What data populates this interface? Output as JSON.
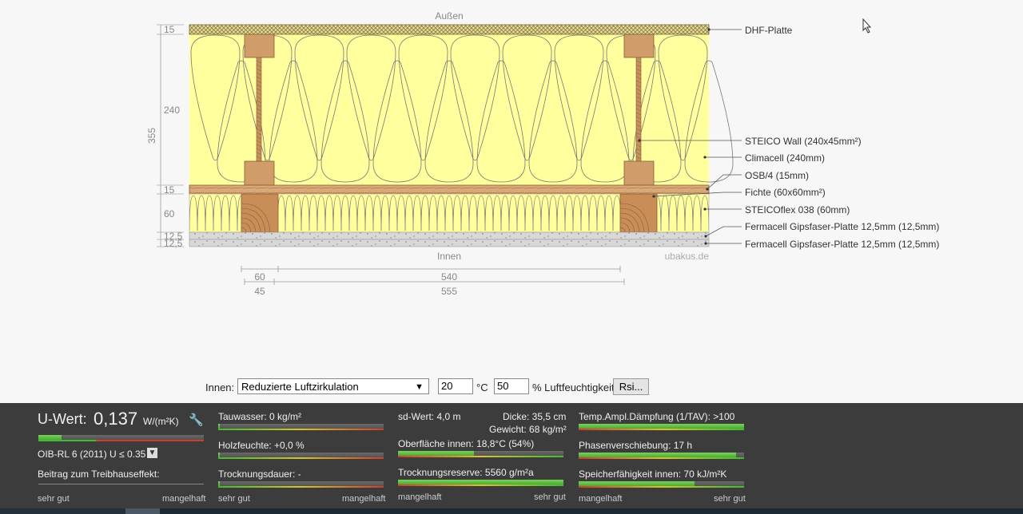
{
  "diagram": {
    "outside_label": "Außen",
    "inside_label": "Innen",
    "watermark": "ubakus.de",
    "left_dims": [
      "15",
      "240",
      "15",
      "60",
      "12,5",
      "12,5"
    ],
    "total_dim": "355",
    "bottom_dims": [
      "60",
      "540",
      "45",
      "555"
    ],
    "layer_labels": [
      "DHF-Platte",
      "STEICO  Wall (240x45mm²)",
      "Climacell (240mm)",
      "OSB/4 (15mm)",
      "Fichte (60x60mm²)",
      "STEICOflex 038 (60mm)",
      "Fermacell Gipsfaser-Platte 12,5mm (12,5mm)",
      "Fermacell Gipsfaser-Platte 12,5mm (12,5mm)"
    ],
    "colors": {
      "insulation": "#ffff9e",
      "wood": "#cf9c6a",
      "gypsum": "#d8d8d8"
    }
  },
  "controls": {
    "inside_label": "Innen:",
    "climate_select": "Reduzierte Luftzirkulation",
    "temperature": "20",
    "temp_unit": "°C",
    "humidity": "50",
    "humidity_unit": "% Luftfeuchtigkeit",
    "rsi_button": "Rsi..."
  },
  "results": {
    "uvalue_label": "U-Wert:",
    "uvalue": "0,137",
    "uvalue_unit": "W/(m²K)",
    "uvalue_fill": 0.14,
    "standard": "OIB-RL 6 (2011) U ≤ 0.35",
    "greenhouse_label": "Beitrag zum Treibhauseffekt:",
    "scale_good": "sehr gut",
    "scale_bad": "mangelhaft",
    "tauwasser": "Tauwasser: 0 kg/m²",
    "holzfeuchte": "Holzfeuchte: +0,0 %",
    "trocknungsdauer": "Trocknungsdauer: -",
    "sd_wert": "sd-Wert: 4,0 m",
    "dicke": "Dicke: 35,5 cm",
    "gewicht": "Gewicht: 68 kg/m²",
    "oberflaeche": "Oberfläche innen: 18,8°C (54%)",
    "oberflaeche_fill": 0.46,
    "trocknungsreserve": "Trocknungsreserve: 5560 g/m²a",
    "trocknungsreserve_fill": 1.0,
    "temp_ampl": "Temp.Ampl.Dämpfung (1/TAV): >100",
    "temp_ampl_fill": 1.0,
    "phasen": "Phasenverschiebung: 17 h",
    "phasen_fill": 0.95,
    "speicher": "Speicherfähigkeit innen: 70 kJ/m²K",
    "speicher_fill": 0.7
  }
}
